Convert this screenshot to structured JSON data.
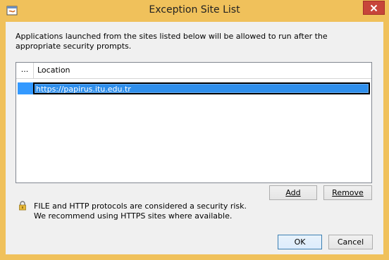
{
  "window": {
    "title": "Exception Site List"
  },
  "description": "Applications launched from the sites listed below will be allowed to run after the appropriate security prompts.",
  "table": {
    "columns": [
      "...",
      "Location"
    ],
    "rows": [
      {
        "location": "https://papirus.itu.edu.tr",
        "selected": true
      }
    ]
  },
  "buttons": {
    "add": "Add",
    "remove": "Remove",
    "ok": "OK",
    "cancel": "Cancel"
  },
  "warning": {
    "line1": "FILE and HTTP protocols are considered a security risk.",
    "line2": "We recommend using HTTPS sites where available."
  },
  "colors": {
    "frame": "#f0c15b",
    "close": "#c7453a",
    "selection": "#3399ff"
  }
}
